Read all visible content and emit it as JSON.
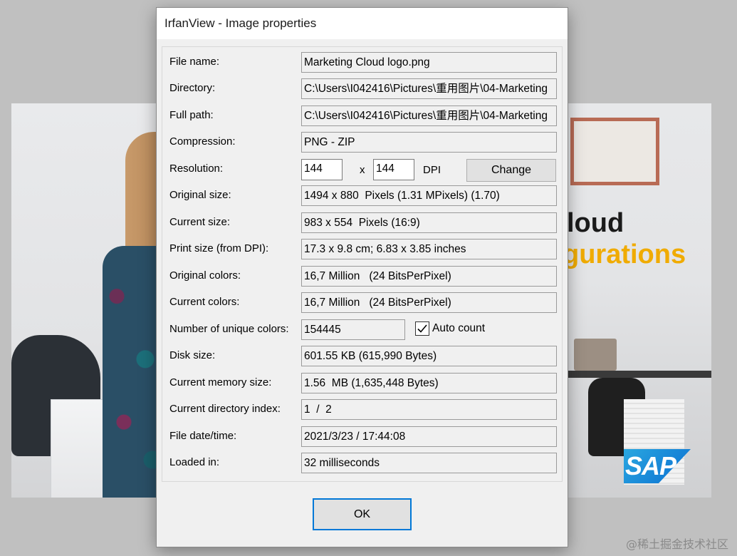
{
  "window": {
    "title": "IrfanView - Image properties"
  },
  "background": {
    "heading_line1": "loud",
    "heading_line2": "gurations",
    "logo_text": "SAP",
    "watermark": "@稀土掘金技术社区",
    "accent_color": "#f0ab00",
    "logo_color": "#0a6ed1"
  },
  "properties": {
    "file_name": {
      "label": "File name:",
      "value": "Marketing Cloud logo.png"
    },
    "directory": {
      "label": "Directory:",
      "value": "C:\\Users\\I042416\\Pictures\\重用图片\\04-Marketing"
    },
    "full_path": {
      "label": "Full path:",
      "value": "C:\\Users\\I042416\\Pictures\\重用图片\\04-Marketing"
    },
    "compression": {
      "label": "Compression:",
      "value": "PNG - ZIP"
    },
    "resolution": {
      "label": "Resolution:",
      "x_value": "144",
      "separator": "x",
      "y_value": "144",
      "unit": "DPI",
      "change_button": "Change"
    },
    "original_size": {
      "label": "Original size:",
      "value": "1494 x 880  Pixels (1.31 MPixels) (1.70)"
    },
    "current_size": {
      "label": "Current size:",
      "value": "983 x 554  Pixels (16:9)"
    },
    "print_size": {
      "label": "Print size (from DPI):",
      "value": "17.3 x 9.8 cm; 6.83 x 3.85 inches"
    },
    "original_colors": {
      "label": "Original colors:",
      "value": "16,7 Million   (24 BitsPerPixel)"
    },
    "current_colors": {
      "label": "Current colors:",
      "value": "16,7 Million   (24 BitsPerPixel)"
    },
    "unique_colors": {
      "label": "Number of unique colors:",
      "value": "154445",
      "auto_count_label": "Auto count",
      "auto_count_checked": true
    },
    "disk_size": {
      "label": "Disk size:",
      "value": "601.55 KB (615,990 Bytes)"
    },
    "memory_size": {
      "label": "Current memory size:",
      "value": "1.56  MB (1,635,448 Bytes)"
    },
    "directory_index": {
      "label": "Current directory index:",
      "value": "1  /  2"
    },
    "file_datetime": {
      "label": "File date/time:",
      "value": "2021/3/23 / 17:44:08"
    },
    "loaded_in": {
      "label": "Loaded in:",
      "value": "32 milliseconds"
    }
  },
  "buttons": {
    "ok": "OK"
  }
}
